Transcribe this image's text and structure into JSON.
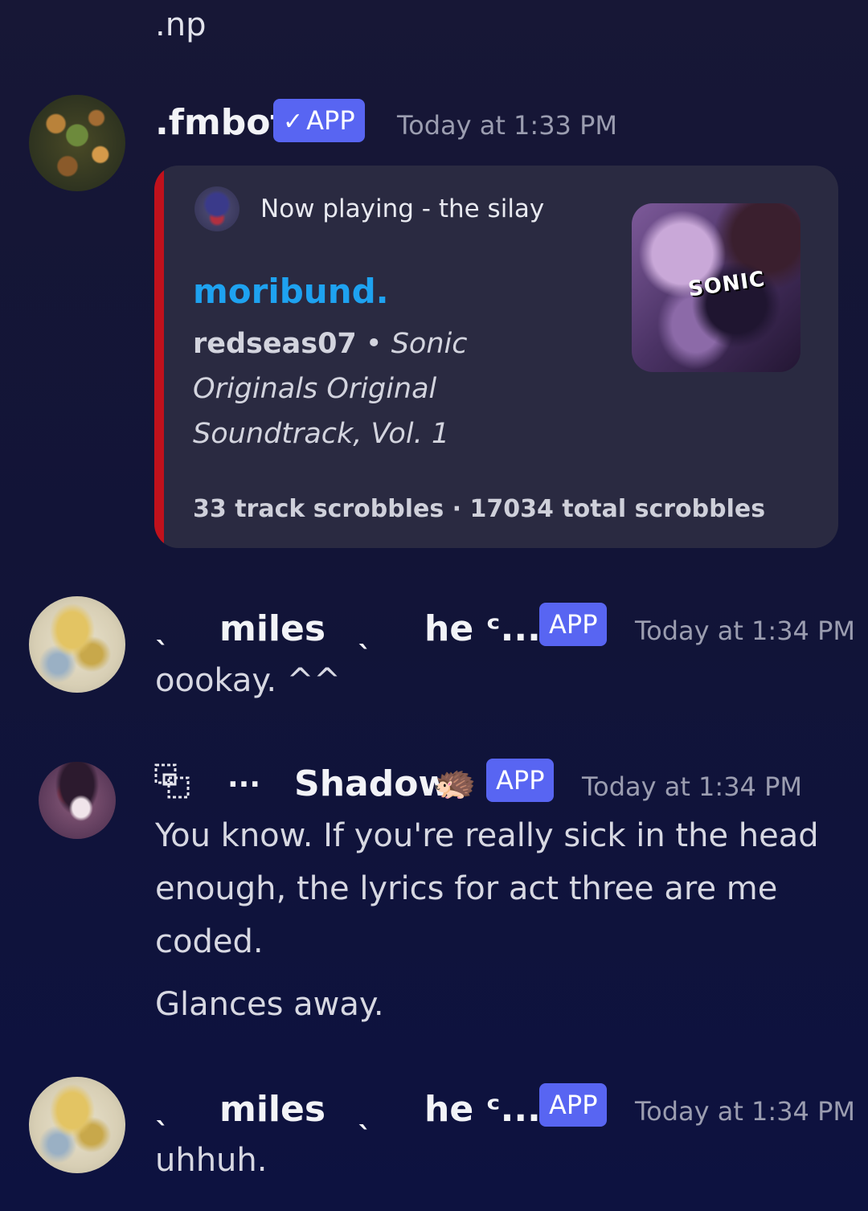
{
  "previous_message": {
    "text": ".np"
  },
  "messages": [
    {
      "username": ".fmbot",
      "badge": "APP",
      "badge_verified": true,
      "timestamp": "Today at 1:33 PM",
      "embed": {
        "author": "Now playing - the silay",
        "title": "moribund.",
        "artist": "redseas07",
        "separator": "•",
        "album": "Sonic Originals Original Soundtrack, Vol. 1",
        "footer": "33 track scrobbles · 17034 total scrobbles",
        "thumbnail_logo": "SONIC",
        "accent_color": "#c0111c",
        "title_color": "#1ea2f0"
      }
    },
    {
      "username_prefix": "ˎ",
      "username": "miles",
      "username_mid": "ˎ",
      "username_suffix": "he ᶜ...",
      "badge": "APP",
      "timestamp": "Today at 1:34 PM",
      "text": "oookay. ^^"
    },
    {
      "username_icon": "fold-box-icon",
      "username_prefix": "···",
      "username": "Shadow",
      "username_emoji": "🦔",
      "badge": "APP",
      "timestamp": "Today at 1:34 PM",
      "text": "You know. If you're really sick in the head enough, the lyrics for act three are me coded.",
      "text2": "Glances away."
    },
    {
      "username_prefix": "ˎ",
      "username": "miles",
      "username_mid": "ˎ",
      "username_suffix": "he ᶜ...",
      "badge": "APP",
      "timestamp": "Today at 1:34 PM",
      "text": "uhhuh."
    }
  ],
  "colors": {
    "background": "#141538",
    "badge": "#5865f2",
    "timestamp": "#9b9db0",
    "embed_background": "#2a2a41"
  }
}
